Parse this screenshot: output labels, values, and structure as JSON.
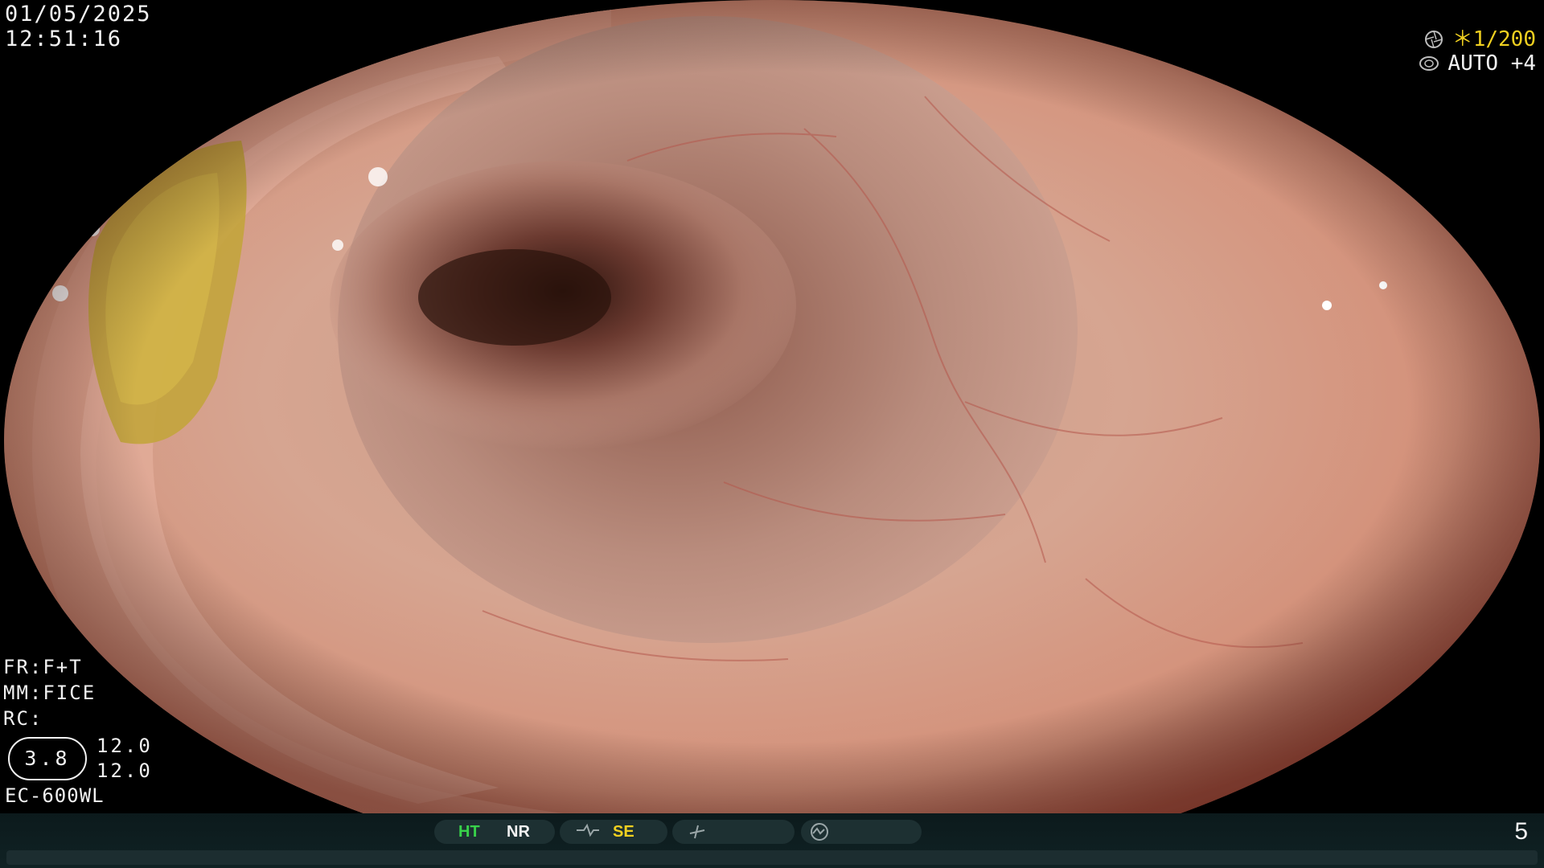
{
  "overlay": {
    "date": "01/05/2025",
    "time": "12:51:16",
    "shutter": "＊1/200",
    "iris": "AUTO +4",
    "fr": "FR:F+T",
    "mm": "MM:FICE",
    "rc": "RC:",
    "badge": "3.8",
    "value_a": "12.0",
    "value_b": "12.0",
    "scope_model": "EC-600WL"
  },
  "status_bar": {
    "ht": "HT",
    "nr": "NR",
    "se": "SE",
    "page": "5"
  },
  "icons": {
    "shutter": "shutter-icon",
    "iris": "iris-icon",
    "structure_enhance": "contour-icon",
    "freeze": "slash-icon",
    "color": "wave-icon"
  },
  "colors": {
    "osd_text": "#f2f2f2",
    "highlight_yellow": "#f0d020",
    "active_green": "#38d24a"
  }
}
